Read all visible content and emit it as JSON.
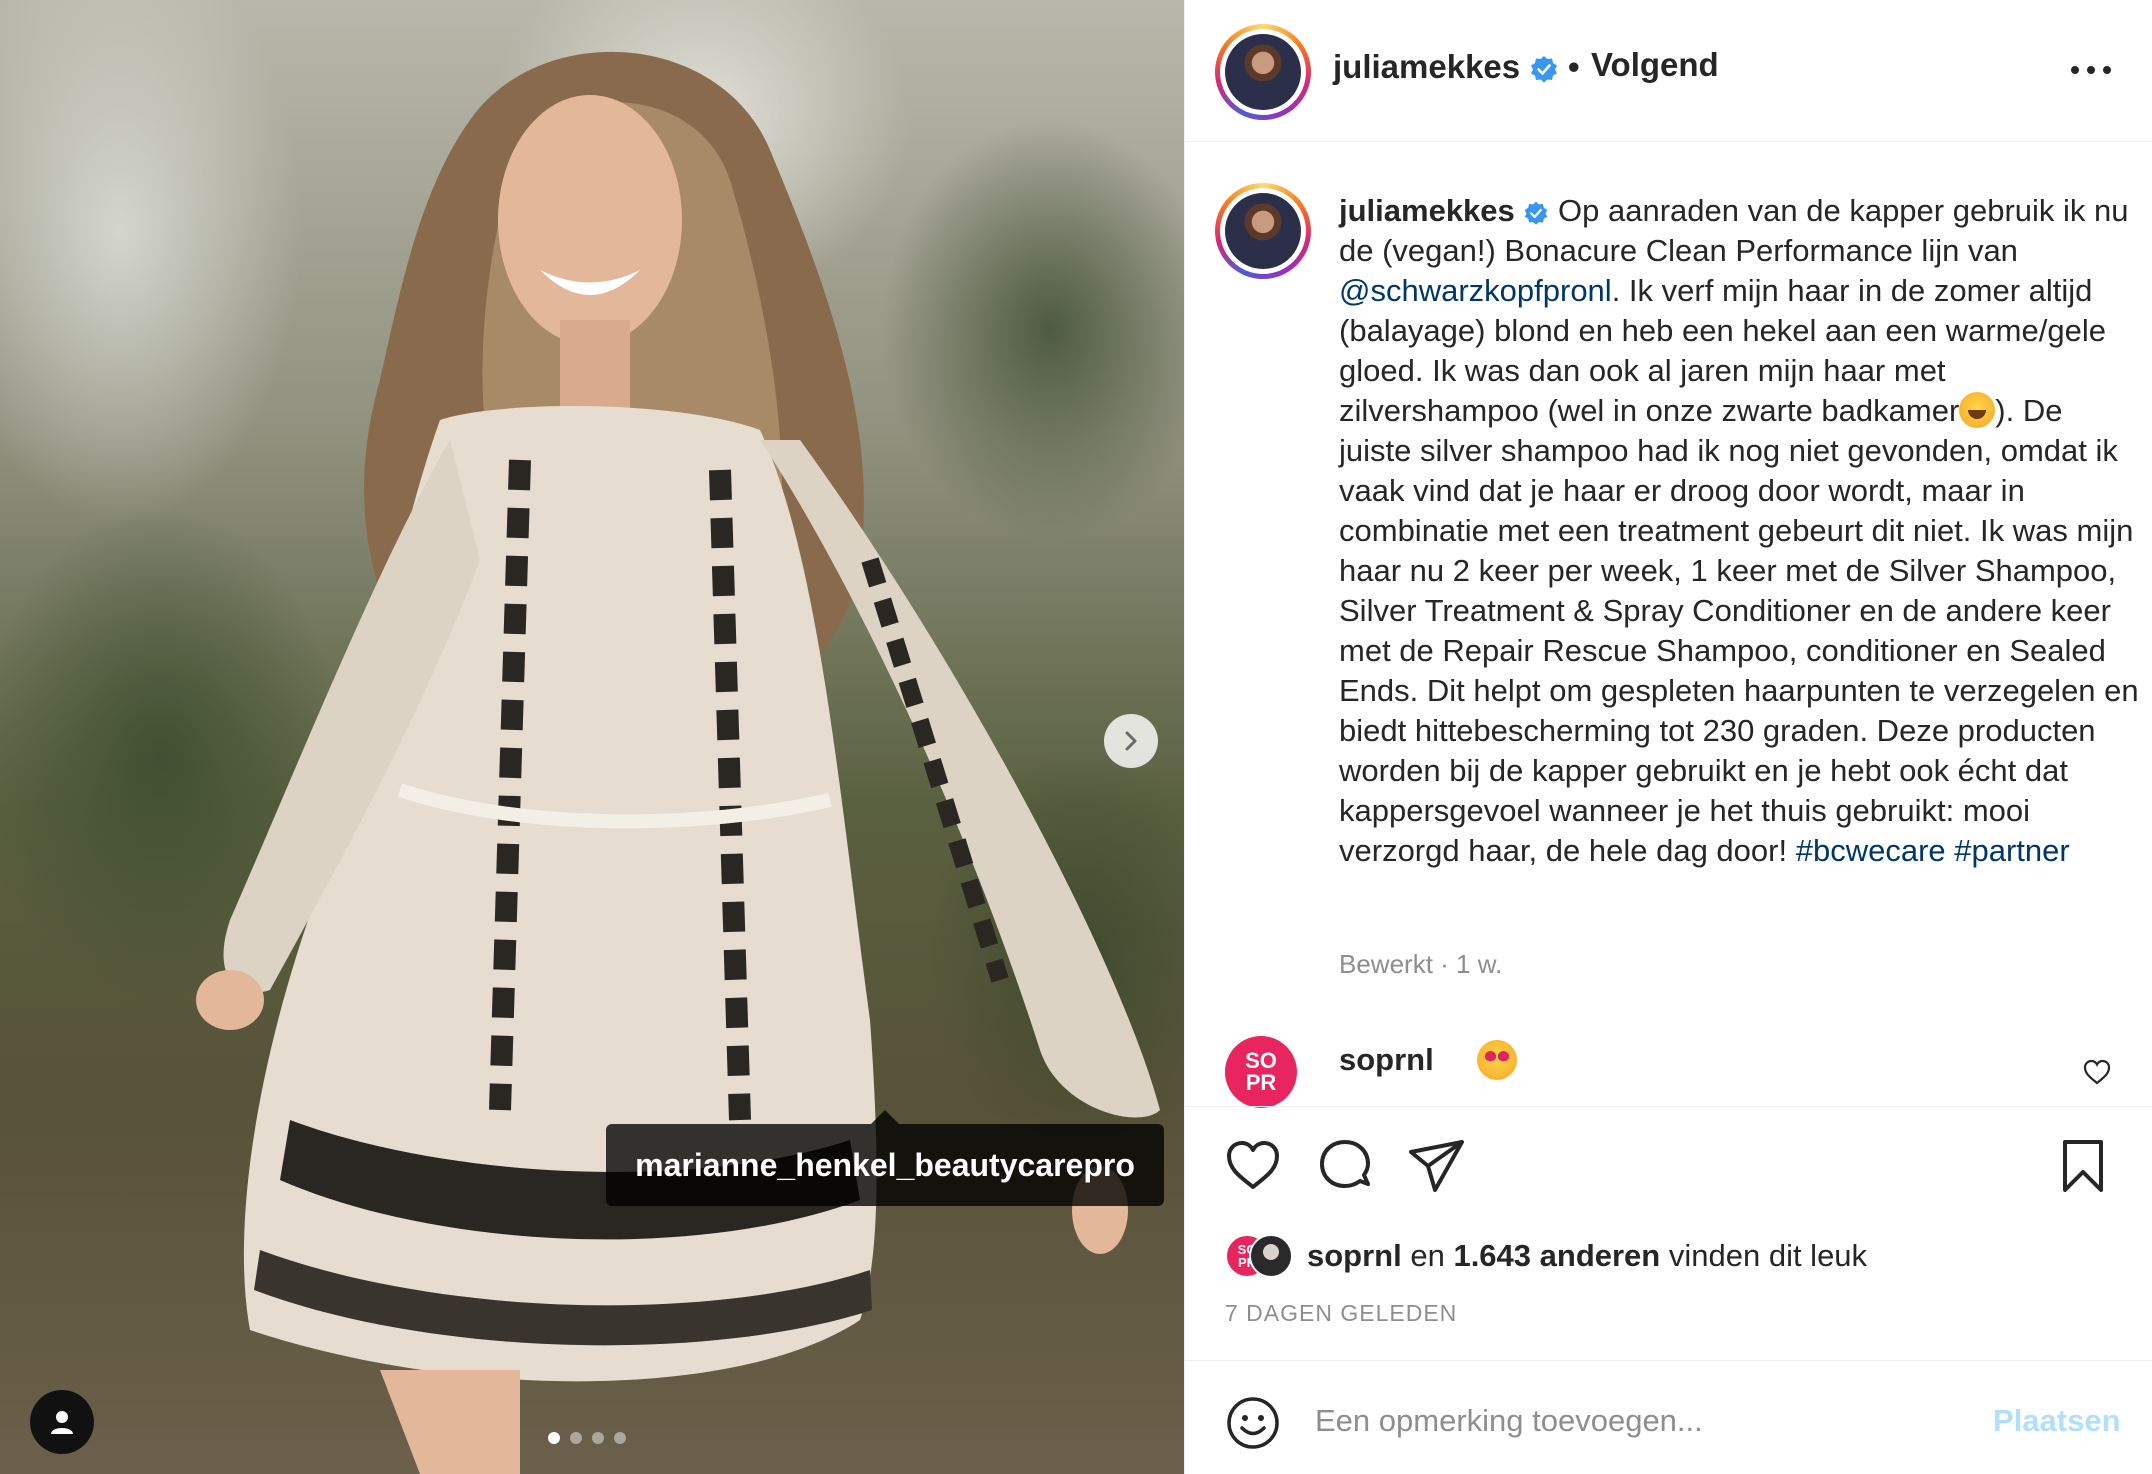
{
  "photo": {
    "tagged_user": "marianne_henkel_beautycarepro",
    "slide_count": 4,
    "active_slide": 1
  },
  "header": {
    "username": "juliamekkes",
    "separator": "•",
    "follow_status": "Volgend"
  },
  "caption": {
    "username": "juliamekkes",
    "text_part1": "Op aanraden van de kapper gebruik ik nu de (vegan!) Bonacure Clean Performance lijn van ",
    "mention": "@schwarzkopfpronl",
    "text_part2": ". Ik verf mijn haar in de zomer altijd (balayage) blond en heb een hekel aan een warme/gele gloed. Ik was dan ook al jaren mijn haar met zilvershampoo (wel in onze zwarte badkamer",
    "text_part3": "). De juiste silver shampoo had ik nog niet gevonden, omdat ik vaak vind dat je haar er droog door wordt, maar in combinatie met een treatment gebeurt dit niet. Ik was mijn haar nu 2 keer per week, 1 keer met de Silver Shampoo, Silver Treatment & Spray Conditioner en de andere keer met de Repair Rescue Shampoo, conditioner en Sealed Ends. Dit helpt om gespleten haarpunten te verzegelen en biedt hittebescherming tot 230 graden. Deze producten worden bij de kapper gebruikt en je hebt ook écht dat kappersgevoel wanneer je het thuis gebruikt: mooi verzorgd haar, de hele dag door! ",
    "hashtag1": "#bcwecare",
    "hashtag2": "#partner",
    "emoji_name": "rolling-on-the-floor-laughing-emoji",
    "meta": "Bewerkt · 1 w."
  },
  "comment": {
    "avatar_text_top": "SO",
    "avatar_text_bottom": "PR",
    "username": "soprnl",
    "emoji_name": "heart-eyes-emoji"
  },
  "likes": {
    "user": "soprnl",
    "middle": " en ",
    "count": "1.643 anderen",
    "suffix": " vinden dit leuk",
    "avatar_text_top": "SO",
    "avatar_text_bottom": "PR"
  },
  "date": "7 DAGEN GELEDEN",
  "add_comment": {
    "placeholder": "Een opmerking toevoegen...",
    "post_label": "Plaatsen"
  },
  "colors": {
    "link": "#00376b",
    "verified": "#3897f0",
    "muted": "#8e8e8e",
    "post_disabled": "#b2dffc",
    "sopr_brand": "#e8255f"
  }
}
